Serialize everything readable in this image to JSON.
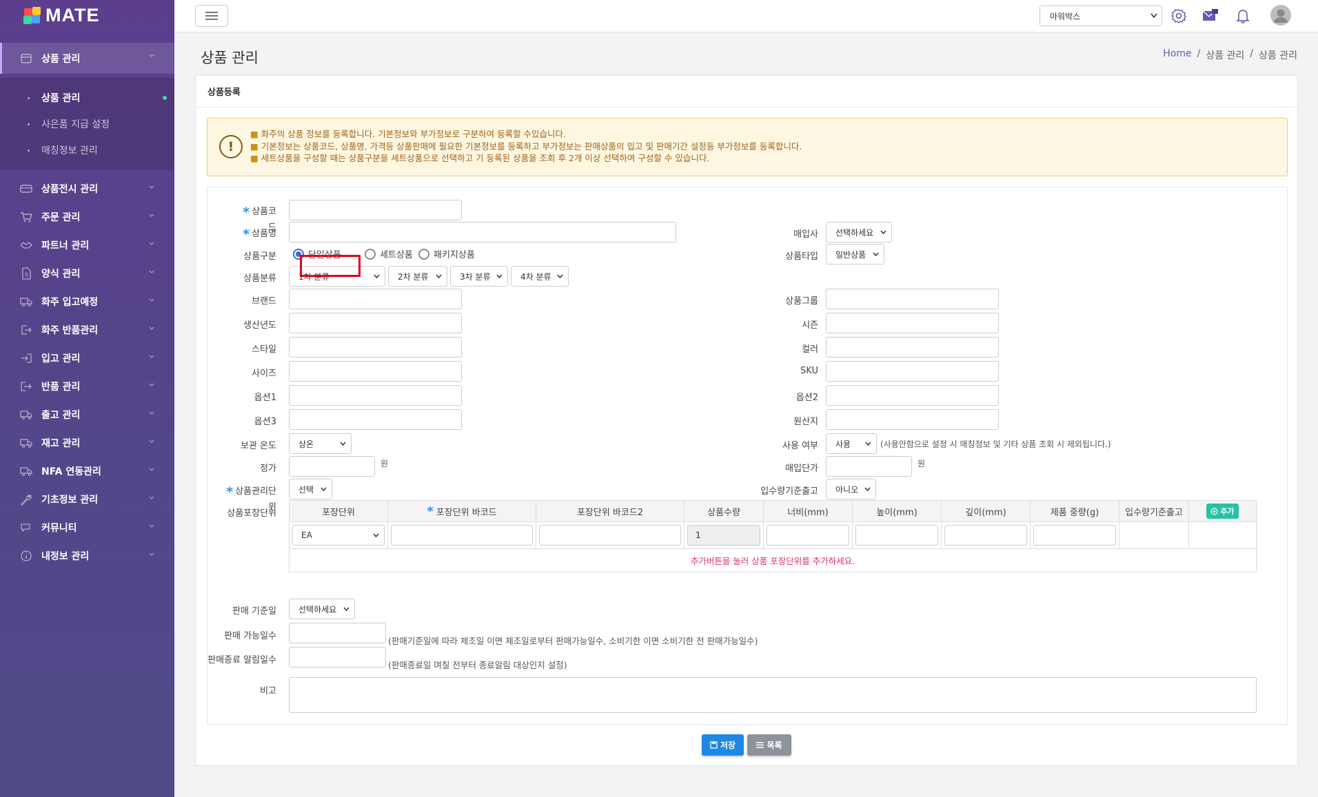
{
  "app": {
    "logo_text": "MATE"
  },
  "sidebar": {
    "items": [
      {
        "label": "상품 관리",
        "icon": "box-icon",
        "active": true,
        "children": [
          {
            "label": "상품 관리",
            "active": true
          },
          {
            "label": "사은품 지급 설정"
          },
          {
            "label": "매칭정보 관리"
          }
        ]
      },
      {
        "label": "상품전시 관리",
        "icon": "display-icon"
      },
      {
        "label": "주문 관리",
        "icon": "cart-icon"
      },
      {
        "label": "파트너 관리",
        "icon": "handshake-icon"
      },
      {
        "label": "양식 관리",
        "icon": "document-icon"
      },
      {
        "label": "화주 입고예정",
        "icon": "truck-in-icon"
      },
      {
        "label": "화주 반품관리",
        "icon": "return-icon"
      },
      {
        "label": "입고 관리",
        "icon": "login-icon"
      },
      {
        "label": "반품 관리",
        "icon": "logout-icon"
      },
      {
        "label": "출고 관리",
        "icon": "truck-icon"
      },
      {
        "label": "재고 관리",
        "icon": "truck-box-icon"
      },
      {
        "label": "NFA 연동관리",
        "icon": "truck-link-icon"
      },
      {
        "label": "기초정보 관리",
        "icon": "wrench-icon"
      },
      {
        "label": "커뮤니티",
        "icon": "chat-icon"
      },
      {
        "label": "내정보 관리",
        "icon": "info-icon"
      }
    ]
  },
  "topbar": {
    "company_select": "아워박스"
  },
  "page": {
    "title": "상품 관리",
    "breadcrumb": [
      "Home",
      "상품 관리",
      "상품 관리"
    ]
  },
  "card": {
    "header": "상품등록"
  },
  "notice": {
    "lines": [
      "화주의 상품 정보를 등록합니다. 기본정보와 부가정보로 구분하여 등록할 수있습니다.",
      "기본정보는 상품코드, 상품명, 가격등 상품판매에 필요한 기본정보를 등록하고 부가정보는 판매상품의 입고 및 판매기간 설정등 부가정보를 등록합니다.",
      "세트상품을 구성할 때는 상품구분을 세트상품으로 선택하고 기 등록된 상품을 조회 후 2개 이상 선택하여 구성할 수 있습니다."
    ]
  },
  "form": {
    "product_code_label": "상품코드",
    "product_name_label": "상품명",
    "buyer_label": "매입사",
    "buyer_select": "선택하세요",
    "category_label": "상품구분",
    "category_options": [
      "단일상품",
      "세트상품",
      "패키지상품"
    ],
    "product_type_label": "상품타입",
    "product_type_select": "일반상품",
    "classification_label": "상품분류",
    "class_selects": [
      "1차 분류",
      "2차 분류",
      "3차 분류",
      "4차 분류"
    ],
    "brand_label": "브랜드",
    "group_label": "상품그룹",
    "year_label": "생산년도",
    "season_label": "시즌",
    "style_label": "스타일",
    "color_label": "컬러",
    "size_label": "사이즈",
    "sku_label": "SKU",
    "option1_label": "옵션1",
    "option2_label": "옵션2",
    "option3_label": "옵션3",
    "origin_label": "원산지",
    "storage_label": "보관 온도",
    "storage_select": "상온",
    "use_label": "사용 여부",
    "use_select": "사용",
    "use_hint": "(사용안함으로 설정 시 매칭정보 및 기타 상품 조회 시 제외됩니다.)",
    "price_label": "정가",
    "price_unit": "원",
    "buy_price_label": "매입단가",
    "buy_price_unit": "원",
    "manage_unit_label": "상품관리단위",
    "manage_unit_select": "선택",
    "inbound_label": "입수량기준출고",
    "inbound_select": "아니오",
    "package_label": "상품포장단위",
    "sale_base_label": "판매 기준일",
    "sale_base_select": "선택하세요",
    "sale_days_label": "판매 가능일수",
    "sale_days_hint": "(판매기준일에 따라 제조일 이면 제조일로부터 판매가능일수, 소비기한 이면 소비기한 전 판매가능일수)",
    "sale_end_label": "판매종료 알림일수",
    "sale_end_hint": "(판매종료일 며칠 전부터 종료알림 대상인지 설정)",
    "remark_label": "비고"
  },
  "package_table": {
    "headers": [
      "포장단위",
      "포장단위 바코드",
      "포장단위 바코드2",
      "상품수량",
      "너비(mm)",
      "높이(mm)",
      "깊이(mm)",
      "제품 중량(g)",
      "입수량기준출고"
    ],
    "add_label": "추가",
    "row": {
      "unit_select": "EA",
      "qty": "1"
    },
    "footer_msg": "추가버튼을 눌러 상품 포장단위를 추가하세요."
  },
  "buttons": {
    "save": "저장",
    "list": "목록"
  },
  "colors": {
    "sidebar": "#5b3f8c",
    "primary": "#1e88e5",
    "accent": "#25c3a4",
    "warning": "#e0306f",
    "highlight": "#e0001a"
  }
}
